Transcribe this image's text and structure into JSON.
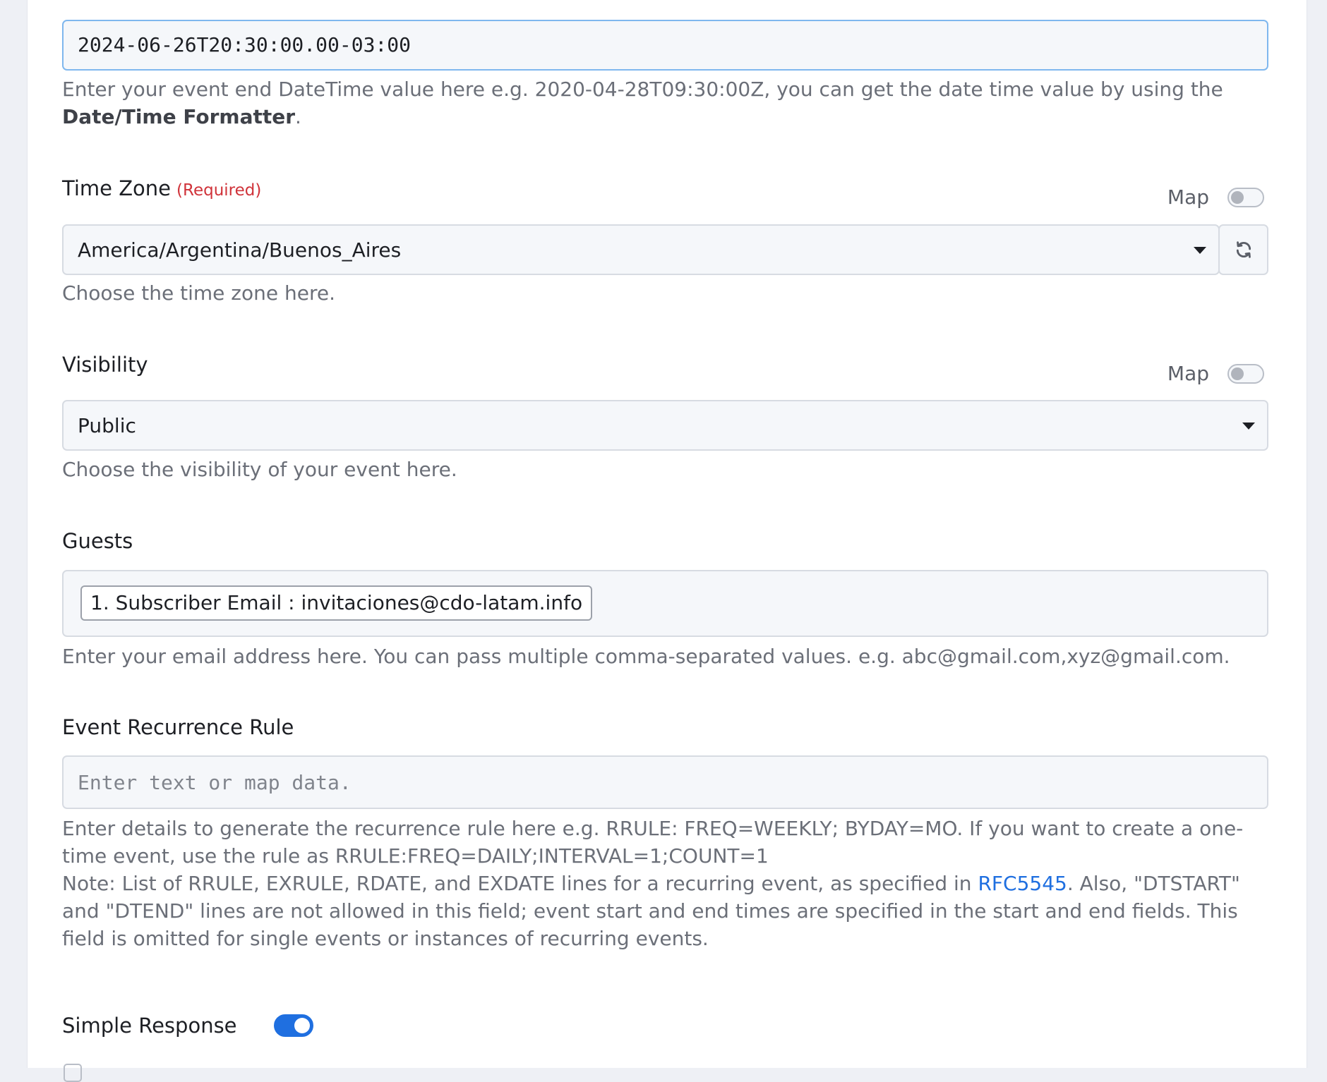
{
  "end_datetime": {
    "value": "2024-06-26T20:30:00.00-03:00",
    "help_prefix": "Enter your event end DateTime value here e.g. 2020-04-28T09:30:00Z, you can get the date time value by using the",
    "help_link": "Date/Time Formatter",
    "help_suffix": "."
  },
  "time_zone": {
    "label": "Time Zone",
    "required": "(Required)",
    "map_label": "Map",
    "value": "America/Argentina/Buenos_Aires",
    "help": "Choose the time zone here.",
    "refresh_icon": "refresh-icon"
  },
  "visibility": {
    "label": "Visibility",
    "map_label": "Map",
    "value": "Public",
    "help": "Choose the visibility of your event here."
  },
  "guests": {
    "label": "Guests",
    "chip": "1. Subscriber Email : invitaciones@cdo-latam.info",
    "help": "Enter your email address here. You can pass multiple comma-separated values. e.g. abc@gmail.com,xyz@gmail.com."
  },
  "recurrence": {
    "label": "Event Recurrence Rule",
    "placeholder": "Enter text or map data.",
    "help_line1": "Enter details to generate the recurrence rule here e.g. RRULE: FREQ=WEEKLY; BYDAY=MO. If you want to create a one-time event, use the rule as RRULE:FREQ=DAILY;INTERVAL=1;COUNT=1",
    "note_prefix": "Note: List of RRULE, EXRULE, RDATE, and EXDATE lines for a recurring event, as specified in",
    "note_link": "RFC5545",
    "note_suffix": ". Also, \"DTSTART\" and \"DTEND\" lines are not allowed in this field; event start and end times are specified in the start and end fields. This field is omitted for single events or instances of recurring events."
  },
  "simple_response": {
    "label": "Simple Response",
    "enabled": true
  },
  "colors": {
    "accent": "#1f6fe0",
    "required": "#d0333a",
    "focus_border": "#7fb7ee"
  }
}
